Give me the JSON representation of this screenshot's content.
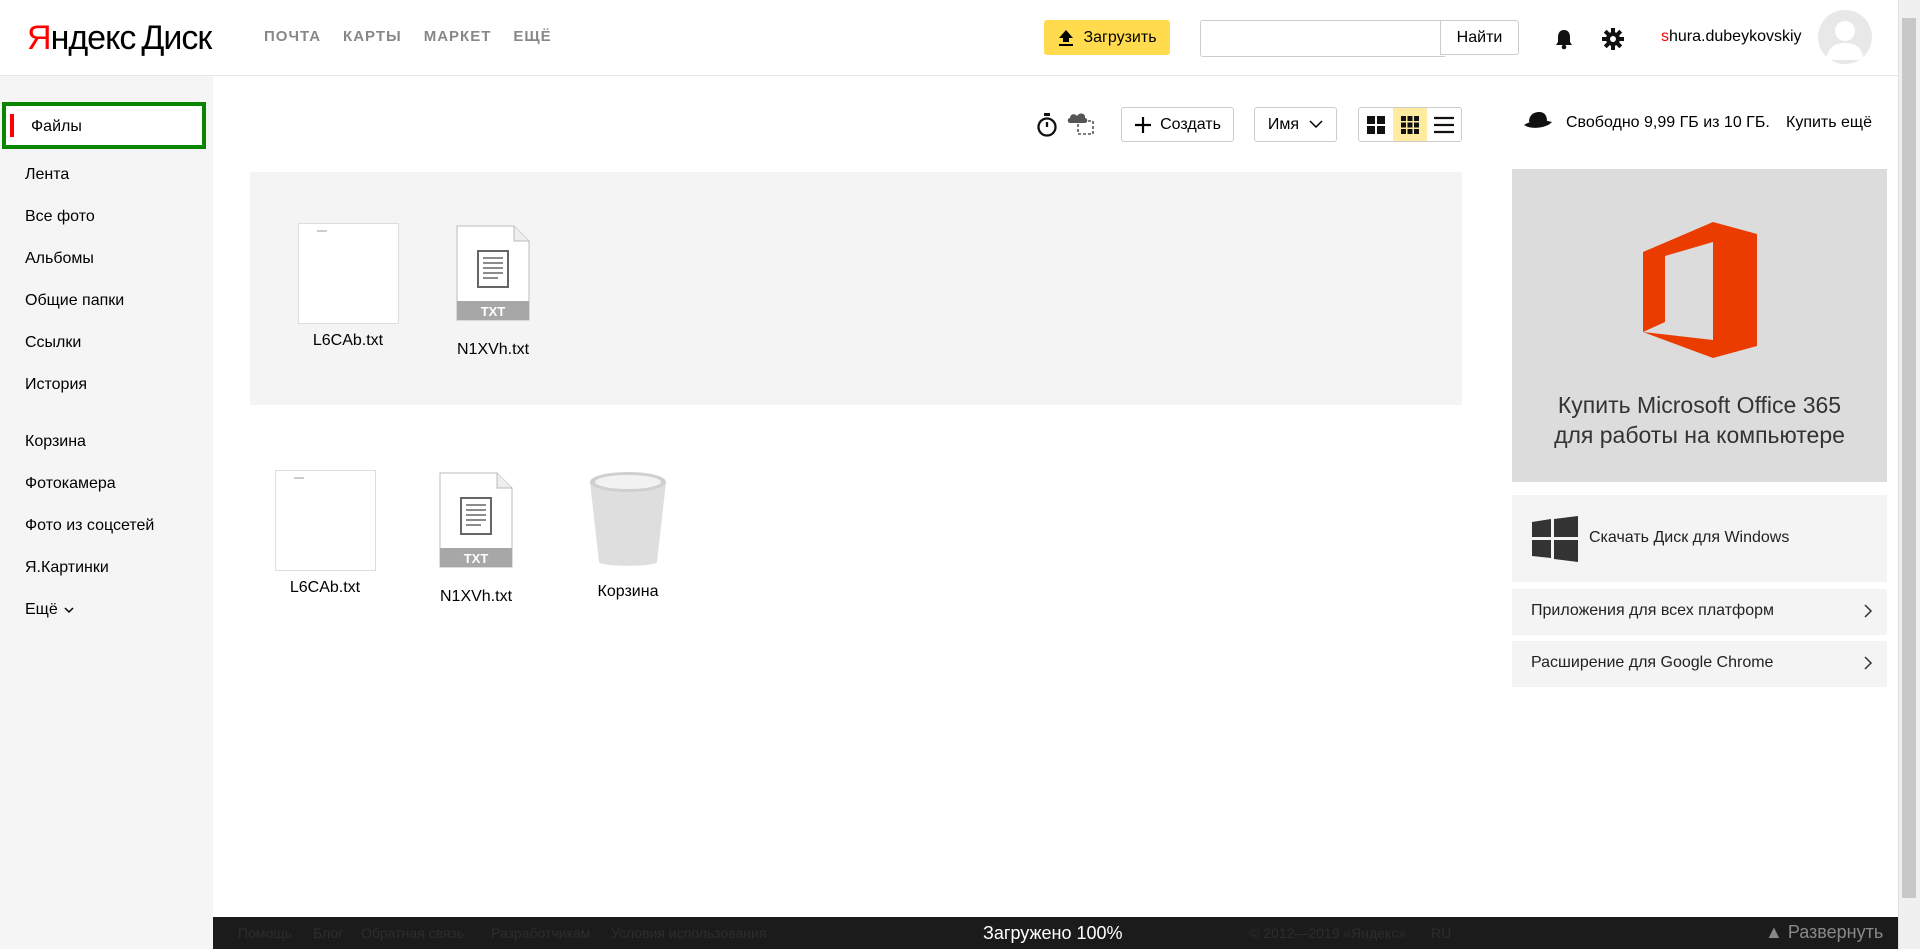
{
  "header": {
    "logo_brand": "Я",
    "logo_rest": "ндекс",
    "logo_product": "Диск",
    "nav": [
      "ПОЧТА",
      "КАРТЫ",
      "МАРКЕТ",
      "ЕЩЁ"
    ],
    "upload_label": "Загрузить",
    "search_value": "",
    "search_button": "Найти",
    "username_first": "s",
    "username_rest": "hura.dubeykovskiy"
  },
  "sidebar": {
    "active": "Файлы",
    "items": [
      "Лента",
      "Все фото",
      "Альбомы",
      "Общие папки",
      "Ссылки",
      "История"
    ],
    "items2": [
      "Корзина",
      "Фотокамера",
      "Фото из соцсетей",
      "Я.Картинки"
    ],
    "more": "Ещё"
  },
  "toolbar": {
    "create_label": "Создать",
    "sort_label": "Имя",
    "storage_text": "Свободно 9,99 ГБ из 10 ГБ.",
    "buy_more": "Купить ещё"
  },
  "recent_files": [
    {
      "name": "L6CAb.txt",
      "thumb": "blank"
    },
    {
      "name": "N1XVh.txt",
      "thumb": "txt"
    }
  ],
  "files": [
    {
      "name": "L6CAb.txt",
      "thumb": "blank"
    },
    {
      "name": "N1XVh.txt",
      "thumb": "txt"
    },
    {
      "name": "Корзина",
      "thumb": "trash"
    }
  ],
  "right": {
    "ad_line1": "Купить Microsoft Office 365",
    "ad_line2": "для работы на компьютере",
    "download_windows": "Скачать Диск для Windows",
    "apps_all": "Приложения для всех платформ",
    "chrome_ext": "Расширение для Google Chrome"
  },
  "footer": {
    "links": [
      "Помощь",
      "Блог",
      "Обратная связь",
      "Разработчикам",
      "Условия использования"
    ],
    "copyright": "© 2012—2019 «Яндекс»",
    "lang": "RU",
    "upload_status": "Загружено 100%",
    "expand": "▲ Развернуть"
  },
  "colors": {
    "accent_yellow": "#ffdb4d",
    "office_red": "#eb3c00",
    "active_marker": "#ff0000",
    "highlight_border": "#0b8400"
  }
}
